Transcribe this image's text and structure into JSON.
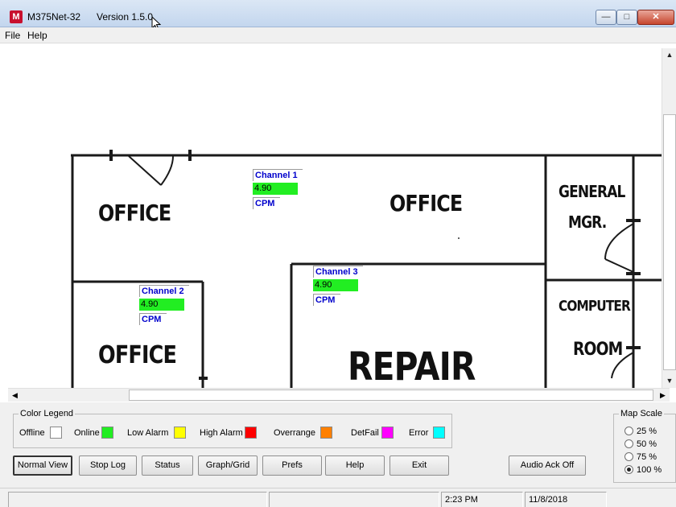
{
  "window": {
    "title": "M375Net-32",
    "version": "Version 1.5.0",
    "icon_letter": "M",
    "controls": {
      "minimize": "—",
      "maximize": "□",
      "close": "✕"
    }
  },
  "menu": {
    "file": "File",
    "help": "Help"
  },
  "map": {
    "rooms": [
      {
        "label": "OFFICE"
      },
      {
        "label": "OFFICE"
      },
      {
        "label": "GENERAL"
      },
      {
        "label": "MGR."
      },
      {
        "label": "COMPUTER"
      },
      {
        "label": "ROOM"
      },
      {
        "label": "OFFICE"
      },
      {
        "label": "REPAIR"
      }
    ],
    "channels": [
      {
        "name": "Channel 1",
        "value": "4.90",
        "unit": "CPM",
        "status": "Online",
        "color": "#22ee22"
      },
      {
        "name": "Channel 2",
        "value": "4.90",
        "unit": "CPM",
        "status": "Online",
        "color": "#22ee22"
      },
      {
        "name": "Channel 3",
        "value": "4.90",
        "unit": "CPM",
        "status": "Online",
        "color": "#22ee22"
      }
    ]
  },
  "legend": {
    "title": "Color Legend",
    "items": [
      {
        "label": "Offline",
        "color": "#ffffff"
      },
      {
        "label": "Online",
        "color": "#22ee22"
      },
      {
        "label": "Low Alarm",
        "color": "#ffff00"
      },
      {
        "label": "High Alarm",
        "color": "#ff0000"
      },
      {
        "label": "Overrange",
        "color": "#ff8000"
      },
      {
        "label": "DetFail",
        "color": "#ff00ff"
      },
      {
        "label": "Error",
        "color": "#00ffff"
      }
    ]
  },
  "map_scale": {
    "title": "Map Scale",
    "options": [
      {
        "label": "25 %",
        "selected": false
      },
      {
        "label": "50 %",
        "selected": false
      },
      {
        "label": "75 %",
        "selected": false
      },
      {
        "label": "100 %",
        "selected": true
      }
    ]
  },
  "buttons": {
    "normal_view": "Normal View",
    "stop_log": "Stop Log",
    "status": "Status",
    "graph_grid": "Graph/Grid",
    "prefs": "Prefs",
    "help": "Help",
    "exit": "Exit",
    "audio_ack": "Audio Ack Off"
  },
  "statusbar": {
    "cell1": "",
    "cell2": "",
    "time": "2:23 PM",
    "date": "11/8/2018"
  }
}
